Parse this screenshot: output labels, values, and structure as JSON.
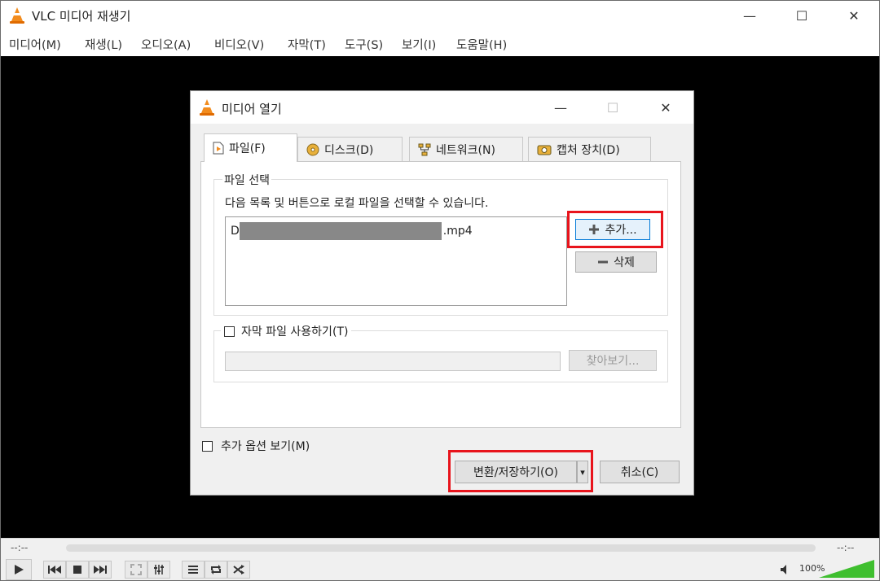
{
  "app": {
    "title": "VLC 미디어 재생기",
    "window_controls": {
      "minimize": "—",
      "maximize": "☐",
      "close": "✕"
    }
  },
  "menu": [
    "미디어(M)",
    "재생(L)",
    "오디오(A)",
    "비디오(V)",
    "자막(T)",
    "도구(S)",
    "보기(I)",
    "도움말(H)"
  ],
  "player": {
    "elapsed": "--:--",
    "remaining": "--:--",
    "volume": "100%",
    "volume_level": 1.0,
    "control_icons": [
      "play-icon",
      "previous-icon",
      "stop-icon",
      "next-icon",
      "fullscreen-icon",
      "extended-settings-icon",
      "playlist-icon",
      "loop-icon",
      "shuffle-icon"
    ]
  },
  "dialog": {
    "title": "미디어 열기",
    "tabs": [
      {
        "label": "파일(F)",
        "icon": "file-icon",
        "active": true
      },
      {
        "label": "디스크(D)",
        "icon": "disc-icon",
        "active": false
      },
      {
        "label": "네트워크(N)",
        "icon": "network-icon",
        "active": false
      },
      {
        "label": "캡처 장치(D)",
        "icon": "capture-icon",
        "active": false
      }
    ],
    "file_section": {
      "label": "파일 선택",
      "hint": "다음 목록 및 버튼으로 로컬 파일을 선택할 수 있습니다.",
      "file_prefix": "D",
      "file_suffix": ".mp4",
      "add_button": "추가...",
      "remove_button": "삭제"
    },
    "subtitle_section": {
      "checkbox_label": "자막 파일 사용하기(T)",
      "checked": false,
      "path_value": "",
      "browse_button": "찾아보기..."
    },
    "more_options": {
      "label": "추가 옵션 보기(M)",
      "checked": false
    },
    "convert_button": "변환/저장하기(O)",
    "dropdown_arrow": "▾",
    "cancel_button": "취소(C)"
  },
  "highlight_color": "#e8141c"
}
